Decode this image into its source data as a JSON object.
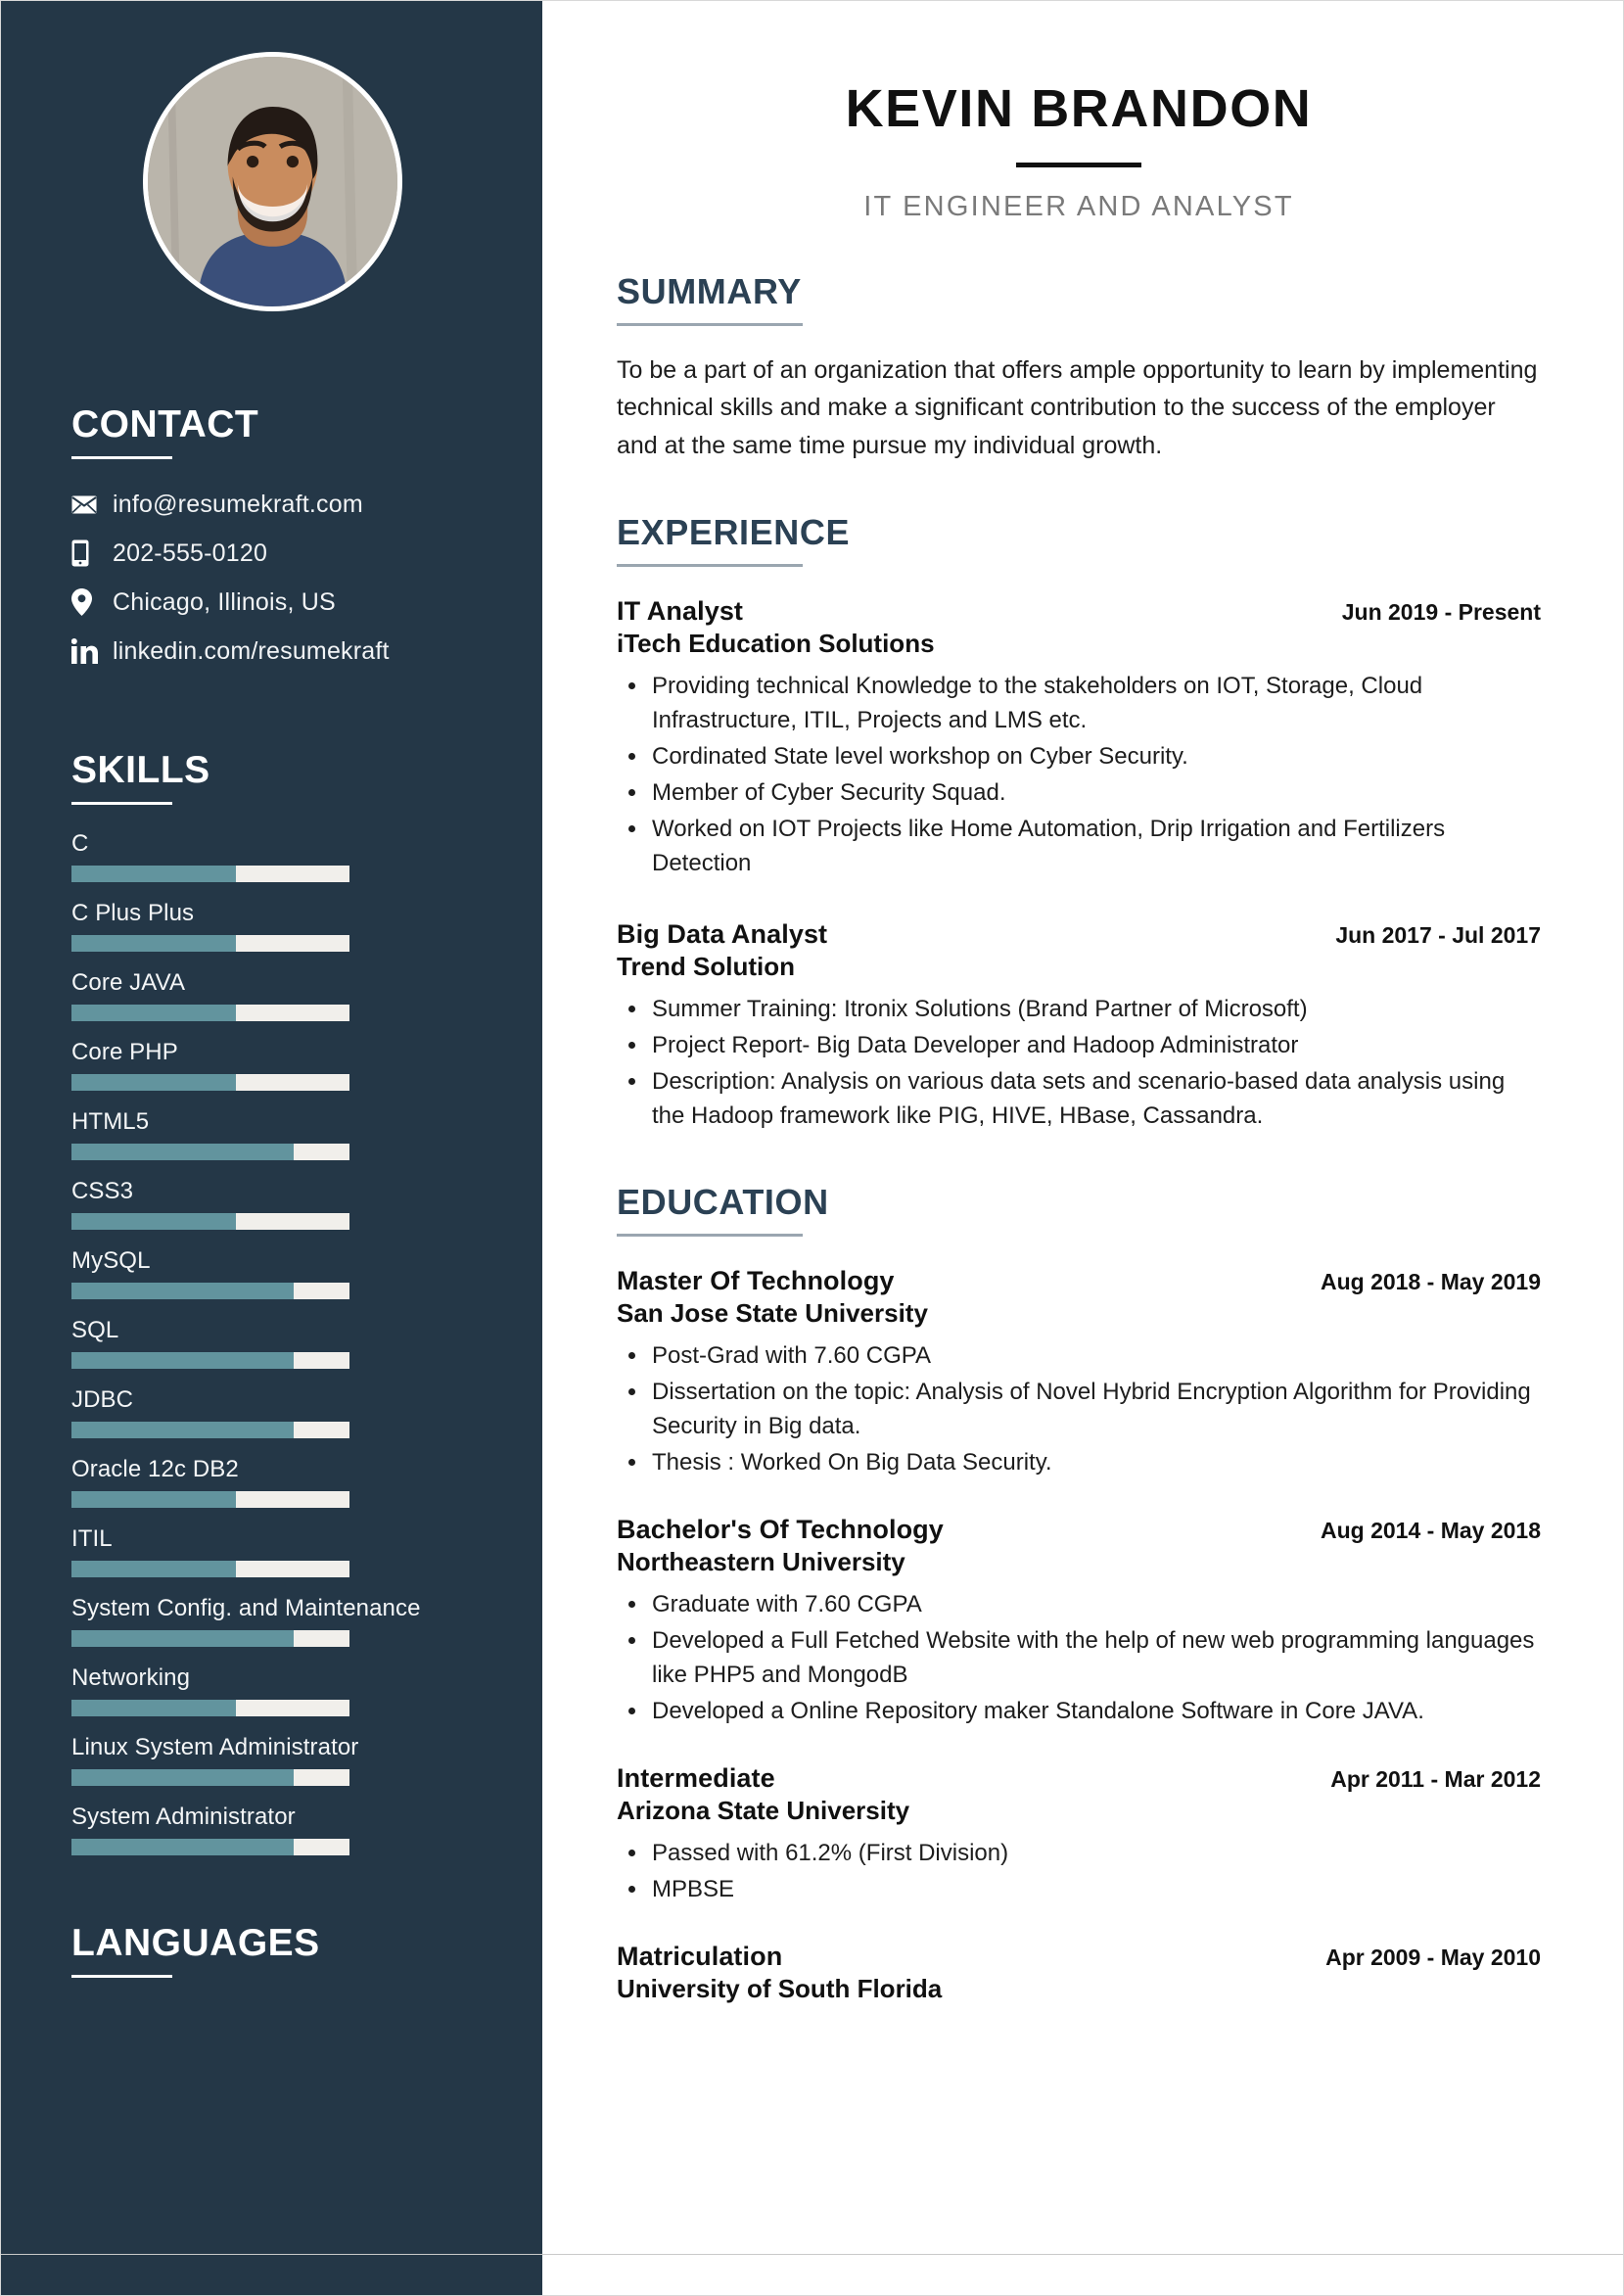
{
  "theme": {
    "sidebar_bg": "#243747",
    "accent_bar": "#62949e",
    "bar_track": "#f1efeb",
    "section_title_color": "#2b4154",
    "job_title_color": "#7a7a7a"
  },
  "header": {
    "full_name": "KEVIN BRANDON",
    "job_title": "IT ENGINEER AND ANALYST"
  },
  "sidebar": {
    "photo_alt": "profile-photo",
    "contact": {
      "heading": "CONTACT",
      "items": [
        {
          "icon": "envelope-icon",
          "text": "info@resumekraft.com"
        },
        {
          "icon": "mobile-phone-icon",
          "text": "202-555-0120"
        },
        {
          "icon": "location-pin-icon",
          "text": "Chicago, Illinois, US"
        },
        {
          "icon": "linkedin-icon",
          "text": "linkedin.com/resumekraft"
        }
      ]
    },
    "skills": {
      "heading": "SKILLS",
      "items": [
        {
          "label": "C",
          "level": 59
        },
        {
          "label": "C Plus Plus",
          "level": 59
        },
        {
          "label": "Core JAVA",
          "level": 59
        },
        {
          "label": "Core PHP",
          "level": 59
        },
        {
          "label": "HTML5",
          "level": 80
        },
        {
          "label": "CSS3",
          "level": 59
        },
        {
          "label": "MySQL",
          "level": 80
        },
        {
          "label": "SQL",
          "level": 80
        },
        {
          "label": "JDBC",
          "level": 80
        },
        {
          "label": "Oracle 12c DB2",
          "level": 59
        },
        {
          "label": "ITIL",
          "level": 59
        },
        {
          "label": "System Config. and Maintenance",
          "level": 80
        },
        {
          "label": "Networking",
          "level": 59
        },
        {
          "label": "Linux System Administrator",
          "level": 80
        },
        {
          "label": "System Administrator",
          "level": 80
        }
      ]
    },
    "languages": {
      "heading": "LANGUAGES"
    }
  },
  "main": {
    "summary": {
      "heading": "SUMMARY",
      "text": "To be a part of an organization that offers ample opportunity to learn by implementing technical skills and make a significant contribution to the success of the employer and at the same time pursue my individual growth."
    },
    "experience": {
      "heading": "EXPERIENCE",
      "entries": [
        {
          "role": "IT Analyst",
          "dates": "Jun 2019 - Present",
          "org": "iTech Education Solutions",
          "bullets": [
            "Providing technical Knowledge to the stakeholders on IOT, Storage, Cloud Infrastructure, ITIL, Projects and LMS etc.",
            "Cordinated State level workshop on Cyber Security.",
            "Member of Cyber Security Squad.",
            "Worked on IOT Projects like Home Automation, Drip Irrigation and Fertilizers Detection"
          ]
        },
        {
          "role": "Big Data Analyst",
          "dates": "Jun 2017 - Jul 2017",
          "org": "Trend Solution",
          "bullets": [
            "Summer Training: Itronix Solutions (Brand Partner of Microsoft)",
            "Project Report- Big Data Developer and Hadoop Administrator",
            "Description: Analysis on various data sets and scenario-based data analysis using the Hadoop framework like PIG, HIVE, HBase, Cassandra."
          ]
        }
      ]
    },
    "education": {
      "heading": "EDUCATION",
      "entries": [
        {
          "role": "Master Of Technology",
          "dates": "Aug 2018 - May 2019",
          "org": "San Jose State University",
          "bullets": [
            "Post-Grad with 7.60 CGPA",
            "Dissertation on the topic: Analysis of Novel Hybrid Encryption Algorithm for Providing Security in Big data.",
            "Thesis : Worked On Big Data Security."
          ]
        },
        {
          "role": "Bachelor's Of Technology",
          "dates": "Aug 2014 - May 2018",
          "org": "Northeastern University",
          "bullets": [
            "Graduate with 7.60 CGPA",
            "Developed a Full Fetched Website with the help of new web programming languages like PHP5 and MongodB",
            "Developed a Online Repository maker Standalone Software in Core JAVA."
          ]
        },
        {
          "role": "Intermediate",
          "dates": "Apr 2011 - Mar 2012",
          "org": "Arizona State University",
          "bullets": [
            "Passed with 61.2% (First Division)",
            "MPBSE"
          ]
        },
        {
          "role": "Matriculation",
          "dates": "Apr 2009 - May 2010",
          "org": "University of South Florida",
          "bullets": []
        }
      ]
    }
  }
}
